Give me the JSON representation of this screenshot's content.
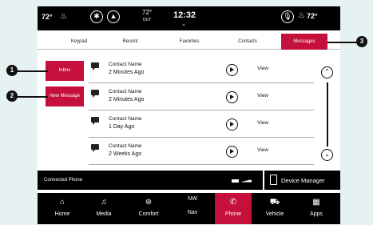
{
  "status_bar": {
    "left_temp": "72°",
    "outside_temp": "72°",
    "outside_label": "OUT",
    "time": "12:32",
    "right_temp": "72°"
  },
  "tabs": [
    {
      "label": "Keypad"
    },
    {
      "label": "Recent"
    },
    {
      "label": "Favorites"
    },
    {
      "label": "Contacts"
    },
    {
      "label": "Messages"
    }
  ],
  "sidebar": {
    "inbox_label": "Inbox",
    "new_message_label": "New Message"
  },
  "messages": [
    {
      "name": "Contact Name",
      "time": "2 Minutes Ago",
      "view": "View"
    },
    {
      "name": "Contact Name",
      "time": "2 Minutes Ago",
      "view": "View"
    },
    {
      "name": "Contact Name",
      "time": "1 Day Ago",
      "view": "View"
    },
    {
      "name": "Contact Name",
      "time": "2 Weeks Ago",
      "view": "View"
    }
  ],
  "connected_phone": {
    "label": "Connected Phone"
  },
  "device_manager": {
    "label": "Device Manager"
  },
  "nav": [
    {
      "label": "Home",
      "icon": "home-icon"
    },
    {
      "label": "Media",
      "icon": "music-note-icon"
    },
    {
      "label": "Comfort",
      "icon": "steering-wheel-icon"
    },
    {
      "label": "Nav",
      "icon": "compass-icon",
      "heading": "NW"
    },
    {
      "label": "Phone",
      "icon": "phone-icon"
    },
    {
      "label": "Vehicle",
      "icon": "car-icon"
    },
    {
      "label": "Apps",
      "icon": "grid-icon"
    }
  ],
  "callouts": [
    "1",
    "2",
    "3"
  ],
  "colors": {
    "accent": "#c4103a",
    "bar": "#000000",
    "background": "#e6f1f1"
  }
}
